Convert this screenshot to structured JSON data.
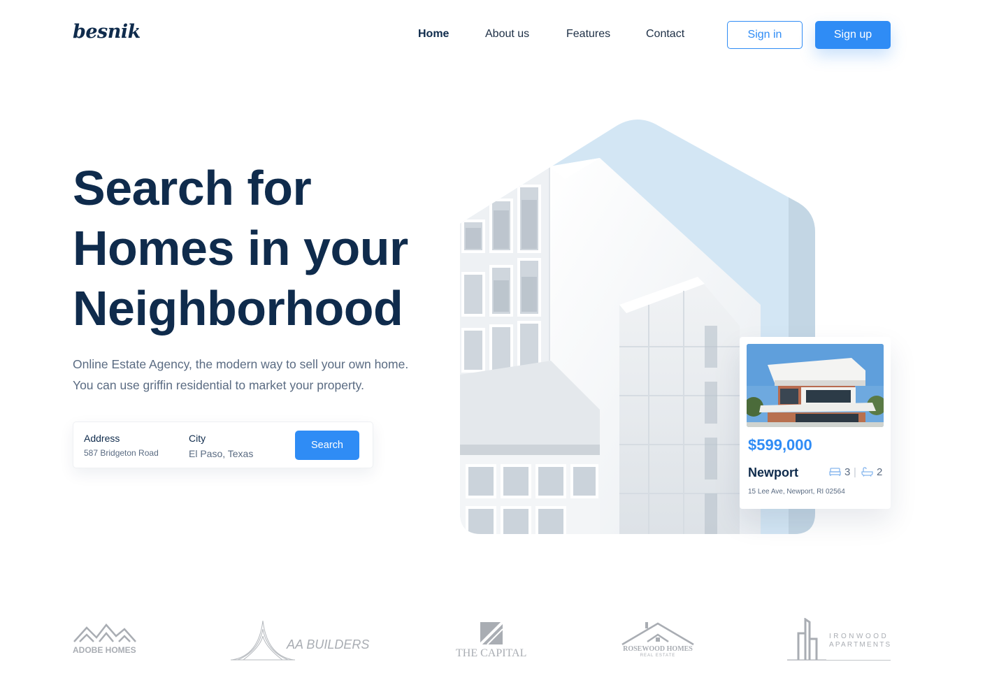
{
  "brand": {
    "name": "besnik"
  },
  "nav": {
    "items": [
      {
        "label": "Home",
        "active": true
      },
      {
        "label": "About us",
        "active": false
      },
      {
        "label": "Features",
        "active": false
      },
      {
        "label": "Contact",
        "active": false
      }
    ],
    "signin_label": "Sign in",
    "signup_label": "Sign up"
  },
  "hero": {
    "title_lines": [
      "Search for",
      "Homes in your",
      "Neighborhood"
    ],
    "subtitle_lines": [
      "Online Estate Agency, the modern way to sell your own home.",
      "You can use griffin residential to market your property."
    ]
  },
  "search": {
    "address_label": "Address",
    "address_value": "587 Bridgeton Road",
    "city_label": "City",
    "city_value": "El Paso, Texas",
    "button_label": "Search"
  },
  "listing": {
    "price": "$599,000",
    "city": "Newport",
    "beds": "3",
    "baths": "2",
    "address": "15 Lee Ave, Newport, RI 02564"
  },
  "partners": [
    {
      "name": "ADOBE HOMES"
    },
    {
      "name": "AA BUILDERS"
    },
    {
      "name": "THE CAPITAL"
    },
    {
      "name": "ROSEWOOD HOMES",
      "tagline": "REAL ESTATE"
    },
    {
      "name": "IRONWOOD",
      "tagline": "APARTMENTS"
    }
  ],
  "colors": {
    "accent": "#2f8cf5",
    "heading": "#0f2b4c",
    "body_text": "#5a6b82",
    "sky": "#d3e6f4",
    "logo_gray": "#a9adb3"
  },
  "icons": [
    "bed-icon",
    "bath-icon"
  ]
}
